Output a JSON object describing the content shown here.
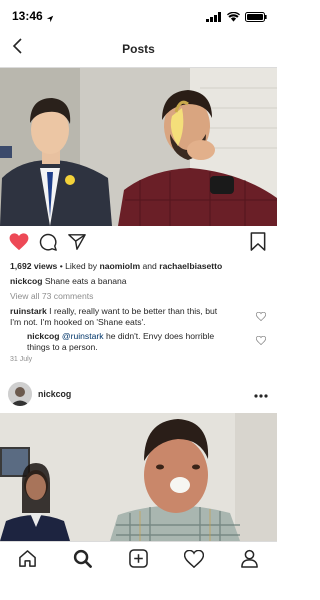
{
  "status_bar": {
    "time": "13:46"
  },
  "nav": {
    "title": "Posts"
  },
  "post": {
    "views": "1,692 views",
    "liked_prefix": " • Liked by ",
    "liked_user1": "naomiolm",
    "liked_and": " and ",
    "liked_user2": "rachaelbiasetto",
    "caption_user": "nickcog",
    "caption_text": " Shane eats a banana",
    "view_all": "View all 73 comments",
    "comments": [
      {
        "user": "ruinstark",
        "line1": " I really, really want to be better than this, but",
        "line2": "I'm not. I'm hooked on 'Shane eats'."
      }
    ],
    "reply": {
      "user": "nickcog",
      "mention": "@ruinstark",
      "line1": " he didn't. Envy does horrible",
      "line2": "things to a person."
    },
    "timestamp": "31 July"
  },
  "post2": {
    "username": "nickcog"
  },
  "icons": {
    "back": "chevron-left-icon",
    "like": "heart-filled-icon",
    "comment": "comment-icon",
    "share": "share-icon",
    "save": "bookmark-icon",
    "more": "more-icon",
    "home": "home-icon",
    "search": "search-icon",
    "add": "add-post-icon",
    "activity": "heart-icon",
    "profile": "profile-icon"
  },
  "colors": {
    "like": "#ed4956",
    "link": "#003569",
    "muted": "#8e8e8e",
    "text": "#262626"
  }
}
